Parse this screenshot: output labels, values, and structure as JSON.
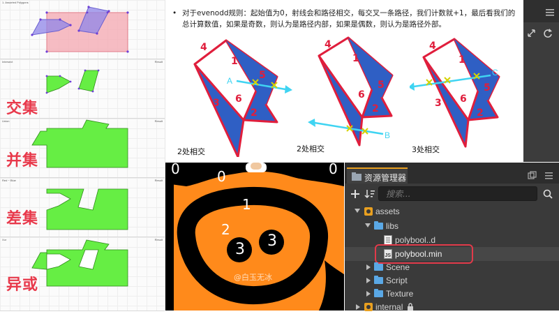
{
  "bool_panel": {
    "sections": [
      {
        "title": "1. Assorted Polygons",
        "result": "",
        "label": ""
      },
      {
        "title": "Intersect",
        "result": "Result",
        "label": "交集"
      },
      {
        "title": "Union",
        "result": "Result",
        "label": "并集"
      },
      {
        "title": "Red − Blue",
        "result": "Result",
        "label": "差集"
      },
      {
        "title": "Xor",
        "result": "Result",
        "label": "异或"
      }
    ]
  },
  "doc": {
    "paragraph": "对于evenodd规则：起始值为0，射线会和路径相交，每交叉一条路径，我们计数就+1，最后看我们的总计算数值，如果是奇数，则认为是路径内部，如果是偶数，则认为是路径外部。",
    "diagrams": [
      {
        "caption": "2处相交",
        "ray": "A",
        "numbers": [
          "4",
          "1",
          "5",
          "3",
          "6",
          "2"
        ]
      },
      {
        "caption": "2处相交",
        "ray": "B",
        "numbers": [
          "4",
          "1",
          "5",
          "6",
          "2"
        ]
      },
      {
        "caption": "3处相交",
        "ray": "C",
        "numbers": [
          "4",
          "1",
          "5",
          "3",
          "6",
          "2"
        ]
      }
    ]
  },
  "game": {
    "numbers": [
      "0",
      "0",
      "0",
      "1",
      "2",
      "3",
      "3"
    ],
    "watermark": "@白玉无冰"
  },
  "assets": {
    "tab_title": "资源管理器",
    "search_placeholder": "搜索...",
    "tree": [
      {
        "label": "assets",
        "type": "root",
        "expanded": true,
        "depth": 0
      },
      {
        "label": "libs",
        "type": "folder",
        "expanded": true,
        "depth": 1
      },
      {
        "label": "polybool..d",
        "type": "file",
        "depth": 2
      },
      {
        "label": "polybool.min",
        "type": "script",
        "depth": 2,
        "selected": true
      },
      {
        "label": "Scene",
        "type": "folder",
        "expanded": false,
        "depth": 1
      },
      {
        "label": "Script",
        "type": "folder",
        "expanded": false,
        "depth": 1
      },
      {
        "label": "Texture",
        "type": "folder",
        "expanded": false,
        "depth": 1
      },
      {
        "label": "internal",
        "type": "root",
        "expanded": false,
        "depth": 0,
        "locked": true
      }
    ]
  },
  "colors": {
    "accent": "#e9a020",
    "selection": "#e23a4a",
    "label_red": "#e8394b",
    "poly_blue": "#2f5fc4",
    "poly_red": "#e01e3c",
    "ray_cyan": "#3fd4f2",
    "game_orange": "#ff8a1b",
    "green": "#66ee44"
  }
}
